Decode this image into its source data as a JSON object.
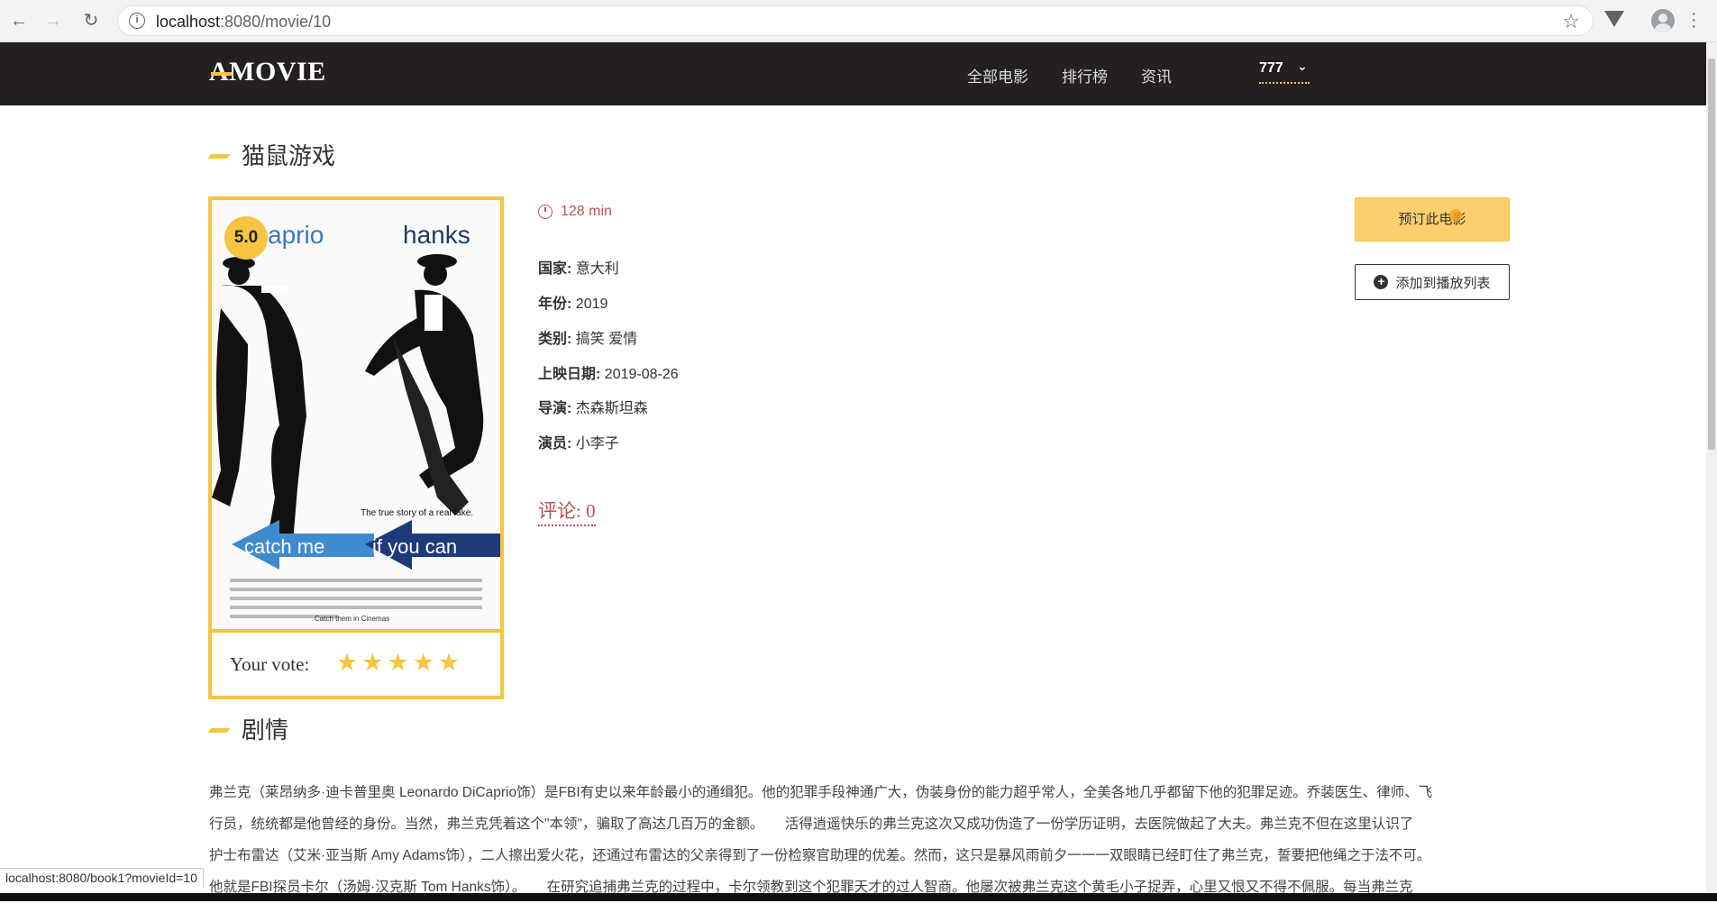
{
  "browser": {
    "url_host": "localhost",
    "url_rest": ":8080/movie/10"
  },
  "header": {
    "logo": "A MOVIE",
    "nav": [
      "全部电影",
      "排行榜",
      "资讯"
    ],
    "user": "777"
  },
  "movie": {
    "title": "猫鼠游戏",
    "rating": "5.0",
    "duration": "128 min",
    "details": [
      {
        "label": "国家:",
        "value": "意大利"
      },
      {
        "label": "年份:",
        "value": "2019"
      },
      {
        "label": "类别:",
        "value": "搞笑 爱情"
      },
      {
        "label": "上映日期:",
        "value": "2019-08-26"
      },
      {
        "label": "导演:",
        "value": "杰森斯坦森"
      },
      {
        "label": "演员:",
        "value": "小李子"
      }
    ],
    "comments": "评论: 0",
    "your_vote_label": "Your vote:",
    "stars": 5,
    "poster_text": {
      "name_left": "aprio",
      "name_right": "hanks",
      "tagline": "The true story of a real fake.",
      "title_left": "catch me",
      "title_right": "if you can",
      "footer": "Catch them in Cinemas"
    }
  },
  "actions": {
    "book": "预订此电影",
    "add_playlist": "添加到播放列表"
  },
  "synopsis": {
    "title": "剧情",
    "lines": [
      "弗兰克（莱昂纳多·迪卡普里奥 Leonardo DiCaprio饰）是FBI有史以来年龄最小的通缉犯。他的犯罪手段神通广大，伪装身份的能力超乎常人，全美各地几乎都留下他的犯罪足迹。乔装医生、律师、飞",
      "行员，统统都是他曾经的身份。当然，弗兰克凭着这个\"本领\"，骗取了高达几百万的金额。　　活得逍遥快乐的弗兰克这次又成功伪造了一份学历证明，去医院做起了大夫。弗兰克不但在这里认识了",
      "护士布雷达（艾米·亚当斯 Amy Adams饰），二人擦出爱火花，还通过布雷达的父亲得到了一份检察官助理的优差。然而，这只是暴风雨前夕一一一双眼睛已经盯住了弗兰克，誓要把他绳之于法不可。",
      "他就是FBI探员卡尔（汤姆·汉克斯 Tom Hanks饰）。　　在研究追捕弗兰克的过程中，卡尔领教到这个犯罪天才的过人智商。他屡次被弗兰克这个黄毛小子捉弄，心里又恨又不得不佩服。每当弗兰克"
    ]
  },
  "status_bar": "localhost:8080/book1?movieId=10",
  "colors": {
    "accent": "#f5c440",
    "header_bg": "#242021",
    "comment_red": "#c0504d"
  }
}
